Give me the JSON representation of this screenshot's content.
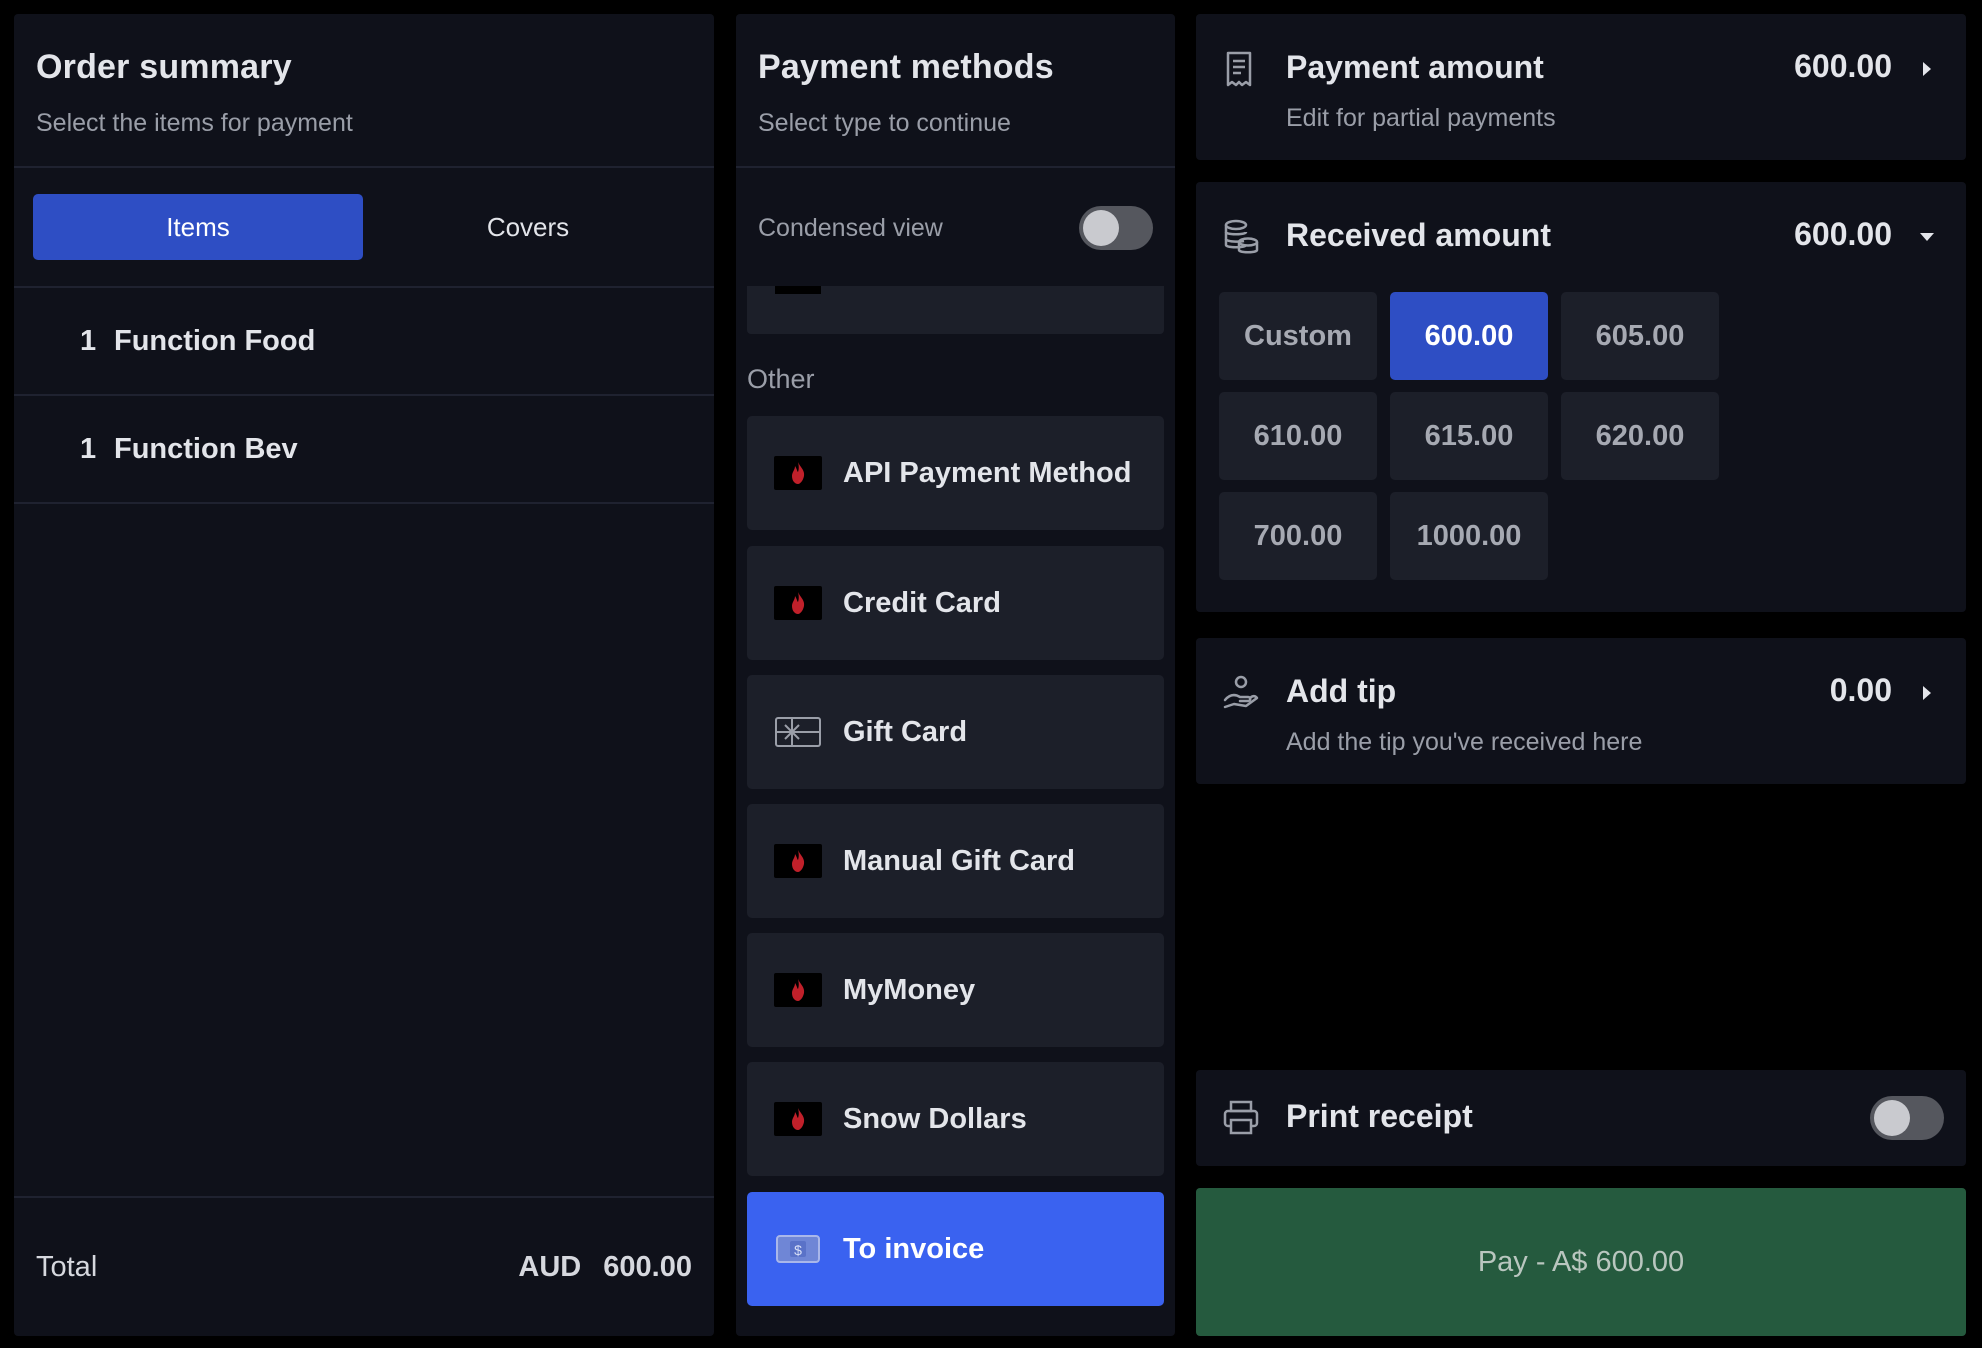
{
  "colors": {
    "background": "#000000",
    "panel": "#0f111a",
    "tile": "#1c1f29",
    "accent_blue": "#2e4ec4",
    "active_method_blue": "#3a62f0",
    "pay_green": "#255a3e"
  },
  "order_summary": {
    "title": "Order summary",
    "subtitle": "Select the items for payment",
    "tabs": {
      "items": "Items",
      "covers": "Covers"
    },
    "items": [
      {
        "qty": "1",
        "name": "Function Food"
      },
      {
        "qty": "1",
        "name": "Function Bev"
      }
    ],
    "total_label": "Total",
    "total_currency": "AUD",
    "total_value": "600.00"
  },
  "payment_methods": {
    "title": "Payment methods",
    "subtitle": "Select type to continue",
    "condensed_view_label": "Condensed view",
    "condensed_view_on": false,
    "other_label": "Other",
    "methods": [
      {
        "label": "API Payment Method",
        "icon": "flame-icon"
      },
      {
        "label": "Credit Card",
        "icon": "flame-icon"
      },
      {
        "label": "Gift Card",
        "icon": "gift-card-icon"
      },
      {
        "label": "Manual Gift Card",
        "icon": "flame-icon"
      },
      {
        "label": "MyMoney",
        "icon": "flame-icon"
      },
      {
        "label": "Snow Dollars",
        "icon": "flame-icon"
      },
      {
        "label": "To invoice",
        "icon": "invoice-icon",
        "selected": true
      }
    ]
  },
  "payment_amount": {
    "title": "Payment amount",
    "subtitle": "Edit for partial payments",
    "value": "600.00",
    "icon": "receipt-icon"
  },
  "received_amount": {
    "title": "Received amount",
    "value": "600.00",
    "icon": "coins-icon",
    "options": [
      "Custom",
      "600.00",
      "605.00",
      "610.00",
      "615.00",
      "620.00",
      "700.00",
      "1000.00"
    ],
    "selected": "600.00"
  },
  "add_tip": {
    "title": "Add tip",
    "subtitle": "Add the tip you've received here",
    "value": "0.00",
    "icon": "tip-hand-icon"
  },
  "print_receipt": {
    "label": "Print receipt",
    "enabled": false,
    "icon": "printer-icon"
  },
  "pay_button": {
    "label": "Pay - A$ 600.00"
  }
}
